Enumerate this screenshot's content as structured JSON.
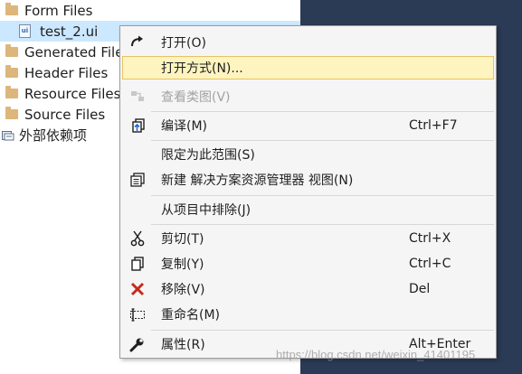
{
  "tree": {
    "items": [
      {
        "label": "Form Files",
        "icon": "folder-icon"
      },
      {
        "label": "test_2.ui",
        "icon": "ui-file-icon",
        "icon_text": "ui",
        "selected": true
      },
      {
        "label": "Generated Files",
        "icon": "folder-icon"
      },
      {
        "label": "Header Files",
        "icon": "folder-icon"
      },
      {
        "label": "Resource Files",
        "icon": "folder-icon"
      },
      {
        "label": "Source Files",
        "icon": "folder-icon"
      },
      {
        "label": "外部依赖项",
        "icon": "external-deps-icon"
      }
    ]
  },
  "menu": {
    "items": [
      {
        "label": "打开(O)",
        "shortcut": "",
        "icon": "open-arrow-icon"
      },
      {
        "label": "打开方式(N)...",
        "shortcut": "",
        "icon": "",
        "highlighted": true
      },
      {
        "label": "查看类图(V)",
        "shortcut": "",
        "icon": "class-diagram-icon",
        "disabled": true
      },
      {
        "label": "编译(M)",
        "shortcut": "Ctrl+F7",
        "icon": "compile-icon"
      },
      {
        "label": "限定为此范围(S)",
        "shortcut": "",
        "icon": ""
      },
      {
        "label": "新建 解决方案资源管理器 视图(N)",
        "shortcut": "",
        "icon": "new-view-icon"
      },
      {
        "label": "从项目中排除(J)",
        "shortcut": "",
        "icon": ""
      },
      {
        "label": "剪切(T)",
        "shortcut": "Ctrl+X",
        "icon": "cut-icon"
      },
      {
        "label": "复制(Y)",
        "shortcut": "Ctrl+C",
        "icon": "copy-icon"
      },
      {
        "label": "移除(V)",
        "shortcut": "Del",
        "icon": "remove-icon"
      },
      {
        "label": "重命名(M)",
        "shortcut": "",
        "icon": "rename-icon"
      },
      {
        "label": "属性(R)",
        "shortcut": "Alt+Enter",
        "icon": "properties-wrench-icon"
      }
    ]
  },
  "colors": {
    "dark_pane": "#2b3a55",
    "selection": "#cce8ff",
    "menu_highlight": "#fdf4bf",
    "remove_icon": "#c42b1c"
  },
  "watermark": "https://blog.csdn.net/weixin_41401195"
}
